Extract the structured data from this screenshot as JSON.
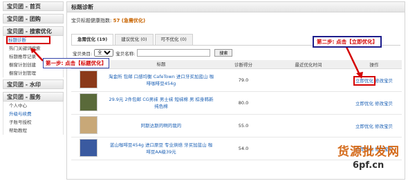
{
  "sidebar": {
    "sections": [
      {
        "title": "宝贝团 - 首页",
        "items": []
      },
      {
        "title": "宝贝团 - 团购",
        "items": []
      },
      {
        "title": "宝贝团 - 搜索优化",
        "items": [
          "标题诊断",
          "热门关键词搜索",
          "标题推荐记录",
          "橱窗计划创建",
          "橱窗计划管理"
        ]
      },
      {
        "title": "宝贝团 - 水印",
        "items": []
      },
      {
        "title": "宝贝团 - 服务",
        "items": [
          "个人中心",
          "升级与续费",
          "子账号授权",
          "帮助教程"
        ]
      }
    ]
  },
  "main": {
    "title": "标题诊断",
    "health_label": "宝贝标题健康指数:",
    "health_value": "57 (急需优化)",
    "tabs": [
      "急需优化 (19)",
      "建议优化 (0)",
      "可不优化 (0)"
    ],
    "filter": {
      "category_label": "宝贝类目:",
      "category_value": "全部",
      "name_label": "宝贝名称:",
      "search_button": "搜索"
    },
    "table": {
      "headers": [
        "",
        "标题",
        "诊断得分",
        "最近优化时间",
        "操作"
      ],
      "rows": [
        {
          "title": "淘金所 包邮 口感均衡 CafeTown 进口牙买加蓝山 咖啡咖啡豆454g",
          "score": "79.0",
          "time": "",
          "op1": "立即优化",
          "op2": "修改宝贝",
          "thumb_color": "#8b3a1a"
        },
        {
          "title": "29.9元 2件包邮 CG男袜 男士袜 短袜棉 男 棕身韩新纯色棉",
          "score": "80.0",
          "time": "",
          "op1": "立即优化",
          "op2": "修改宝贝",
          "thumb_color": "#5a6a3a"
        },
        {
          "title": "阿斯达斯的啊的我的",
          "score": "55.0",
          "time": "",
          "op1": "立即优化",
          "op2": "修改宝贝",
          "thumb_color": "#c8a878"
        },
        {
          "title": "蓝山咖啡豆454g 进口原豆 专业烘焙 牙买加蓝山 咖啡豆AA级39元",
          "score": "54.0",
          "time": "",
          "op1": "立即优化",
          "op2": "修改宝贝",
          "thumb_color": "#3a5aa0"
        }
      ]
    }
  },
  "callouts": {
    "step1": "第一步: 点击【标题优化】",
    "step2": "第二步: 点击【立即优化】",
    "watermark": "货源批发网",
    "watermark2": "6pf.cn"
  }
}
